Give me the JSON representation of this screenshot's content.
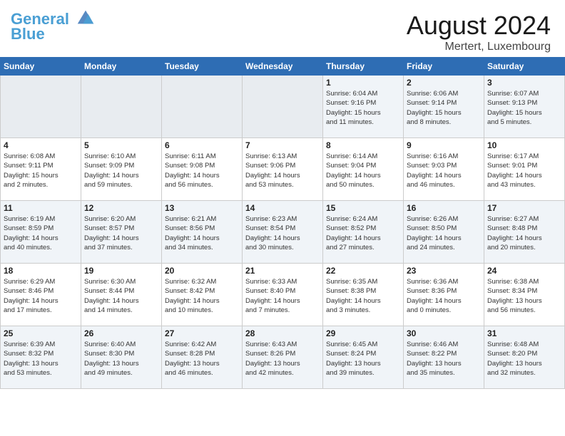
{
  "logo": {
    "line1": "General",
    "line2": "Blue"
  },
  "title": "August 2024",
  "subtitle": "Mertert, Luxembourg",
  "days_of_week": [
    "Sunday",
    "Monday",
    "Tuesday",
    "Wednesday",
    "Thursday",
    "Friday",
    "Saturday"
  ],
  "weeks": [
    [
      {
        "day": "",
        "info": ""
      },
      {
        "day": "",
        "info": ""
      },
      {
        "day": "",
        "info": ""
      },
      {
        "day": "",
        "info": ""
      },
      {
        "day": "1",
        "info": "Sunrise: 6:04 AM\nSunset: 9:16 PM\nDaylight: 15 hours\nand 11 minutes."
      },
      {
        "day": "2",
        "info": "Sunrise: 6:06 AM\nSunset: 9:14 PM\nDaylight: 15 hours\nand 8 minutes."
      },
      {
        "day": "3",
        "info": "Sunrise: 6:07 AM\nSunset: 9:13 PM\nDaylight: 15 hours\nand 5 minutes."
      }
    ],
    [
      {
        "day": "4",
        "info": "Sunrise: 6:08 AM\nSunset: 9:11 PM\nDaylight: 15 hours\nand 2 minutes."
      },
      {
        "day": "5",
        "info": "Sunrise: 6:10 AM\nSunset: 9:09 PM\nDaylight: 14 hours\nand 59 minutes."
      },
      {
        "day": "6",
        "info": "Sunrise: 6:11 AM\nSunset: 9:08 PM\nDaylight: 14 hours\nand 56 minutes."
      },
      {
        "day": "7",
        "info": "Sunrise: 6:13 AM\nSunset: 9:06 PM\nDaylight: 14 hours\nand 53 minutes."
      },
      {
        "day": "8",
        "info": "Sunrise: 6:14 AM\nSunset: 9:04 PM\nDaylight: 14 hours\nand 50 minutes."
      },
      {
        "day": "9",
        "info": "Sunrise: 6:16 AM\nSunset: 9:03 PM\nDaylight: 14 hours\nand 46 minutes."
      },
      {
        "day": "10",
        "info": "Sunrise: 6:17 AM\nSunset: 9:01 PM\nDaylight: 14 hours\nand 43 minutes."
      }
    ],
    [
      {
        "day": "11",
        "info": "Sunrise: 6:19 AM\nSunset: 8:59 PM\nDaylight: 14 hours\nand 40 minutes."
      },
      {
        "day": "12",
        "info": "Sunrise: 6:20 AM\nSunset: 8:57 PM\nDaylight: 14 hours\nand 37 minutes."
      },
      {
        "day": "13",
        "info": "Sunrise: 6:21 AM\nSunset: 8:56 PM\nDaylight: 14 hours\nand 34 minutes."
      },
      {
        "day": "14",
        "info": "Sunrise: 6:23 AM\nSunset: 8:54 PM\nDaylight: 14 hours\nand 30 minutes."
      },
      {
        "day": "15",
        "info": "Sunrise: 6:24 AM\nSunset: 8:52 PM\nDaylight: 14 hours\nand 27 minutes."
      },
      {
        "day": "16",
        "info": "Sunrise: 6:26 AM\nSunset: 8:50 PM\nDaylight: 14 hours\nand 24 minutes."
      },
      {
        "day": "17",
        "info": "Sunrise: 6:27 AM\nSunset: 8:48 PM\nDaylight: 14 hours\nand 20 minutes."
      }
    ],
    [
      {
        "day": "18",
        "info": "Sunrise: 6:29 AM\nSunset: 8:46 PM\nDaylight: 14 hours\nand 17 minutes."
      },
      {
        "day": "19",
        "info": "Sunrise: 6:30 AM\nSunset: 8:44 PM\nDaylight: 14 hours\nand 14 minutes."
      },
      {
        "day": "20",
        "info": "Sunrise: 6:32 AM\nSunset: 8:42 PM\nDaylight: 14 hours\nand 10 minutes."
      },
      {
        "day": "21",
        "info": "Sunrise: 6:33 AM\nSunset: 8:40 PM\nDaylight: 14 hours\nand 7 minutes."
      },
      {
        "day": "22",
        "info": "Sunrise: 6:35 AM\nSunset: 8:38 PM\nDaylight: 14 hours\nand 3 minutes."
      },
      {
        "day": "23",
        "info": "Sunrise: 6:36 AM\nSunset: 8:36 PM\nDaylight: 14 hours\nand 0 minutes."
      },
      {
        "day": "24",
        "info": "Sunrise: 6:38 AM\nSunset: 8:34 PM\nDaylight: 13 hours\nand 56 minutes."
      }
    ],
    [
      {
        "day": "25",
        "info": "Sunrise: 6:39 AM\nSunset: 8:32 PM\nDaylight: 13 hours\nand 53 minutes."
      },
      {
        "day": "26",
        "info": "Sunrise: 6:40 AM\nSunset: 8:30 PM\nDaylight: 13 hours\nand 49 minutes."
      },
      {
        "day": "27",
        "info": "Sunrise: 6:42 AM\nSunset: 8:28 PM\nDaylight: 13 hours\nand 46 minutes."
      },
      {
        "day": "28",
        "info": "Sunrise: 6:43 AM\nSunset: 8:26 PM\nDaylight: 13 hours\nand 42 minutes."
      },
      {
        "day": "29",
        "info": "Sunrise: 6:45 AM\nSunset: 8:24 PM\nDaylight: 13 hours\nand 39 minutes."
      },
      {
        "day": "30",
        "info": "Sunrise: 6:46 AM\nSunset: 8:22 PM\nDaylight: 13 hours\nand 35 minutes."
      },
      {
        "day": "31",
        "info": "Sunrise: 6:48 AM\nSunset: 8:20 PM\nDaylight: 13 hours\nand 32 minutes."
      }
    ]
  ]
}
